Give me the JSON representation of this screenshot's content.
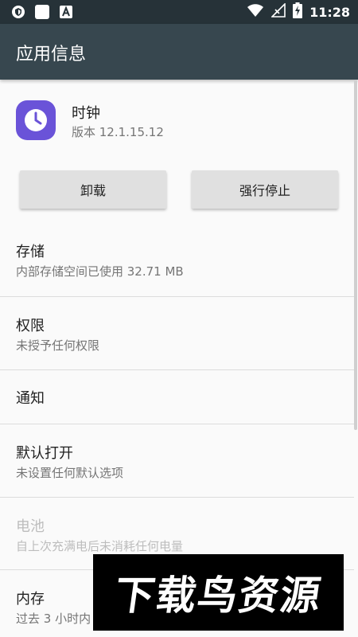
{
  "status_bar": {
    "time": "11:28",
    "left_icons": [
      "shield-icon",
      "white-square-icon",
      "font-a-icon"
    ],
    "right_icons": [
      "wifi-icon",
      "no-signal-icon",
      "battery-charging-icon"
    ]
  },
  "toolbar": {
    "title": "应用信息"
  },
  "app": {
    "name": "时钟",
    "version": "版本 12.1.15.12",
    "icon": "clock-icon",
    "icon_color": "#6a53d8"
  },
  "buttons": {
    "uninstall": "卸载",
    "force_stop": "强行停止"
  },
  "prefs": {
    "storage": {
      "title": "存储",
      "summary": "内部存储空间已使用 32.71 MB"
    },
    "permissions": {
      "title": "权限",
      "summary": "未授予任何权限"
    },
    "notifications": {
      "title": "通知"
    },
    "open_by_default": {
      "title": "默认打开",
      "summary": "未设置任何默认选项"
    },
    "battery": {
      "title": "电池",
      "summary": "自上次充满电后未消耗任何电量"
    },
    "memory": {
      "title": "内存",
      "summary": "过去 3 小时内"
    }
  },
  "watermark": {
    "text": "下载鸟资源"
  },
  "colors": {
    "status_bar": "#263238",
    "toolbar": "#37474f",
    "background": "#fafafa",
    "button": "#e0e0e0"
  }
}
